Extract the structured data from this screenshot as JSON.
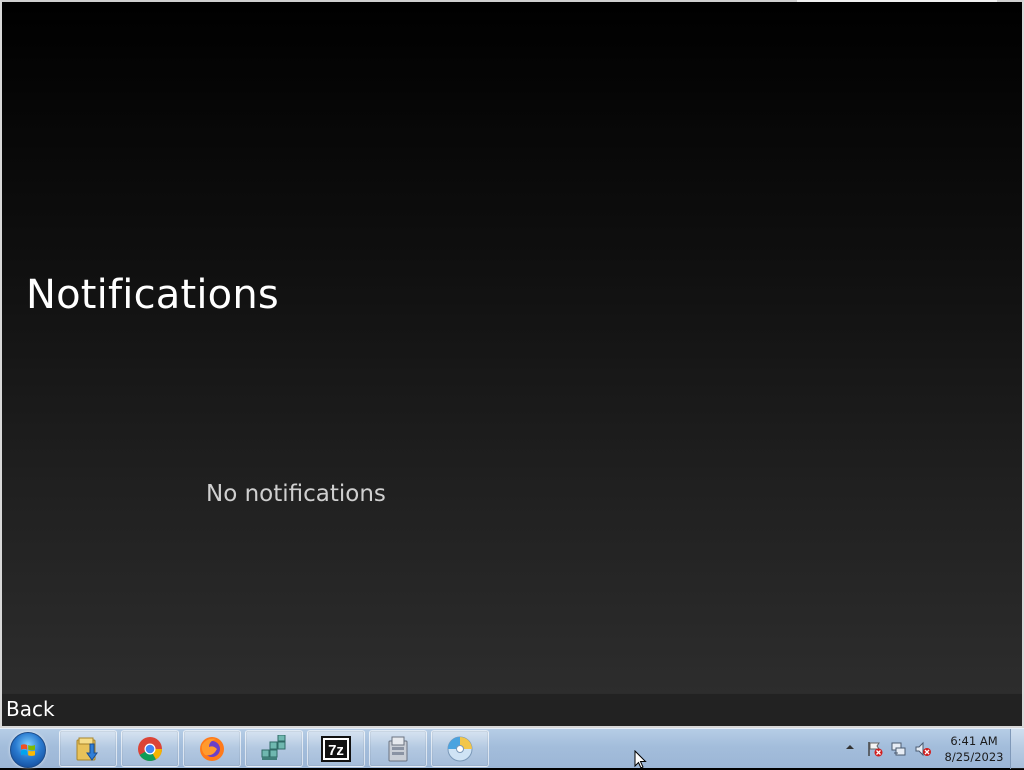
{
  "window": {
    "title": "Notifications",
    "empty_message": "No notifications"
  },
  "app_bar": {
    "back_label": "Back"
  },
  "taskbar": {
    "pinned": [
      {
        "name": "windows-explorer",
        "icon": "folder-icon"
      },
      {
        "name": "google-chrome",
        "icon": "chrome-icon"
      },
      {
        "name": "firefox",
        "icon": "firefox-icon"
      },
      {
        "name": "registry-tool",
        "icon": "registry-cubes-icon"
      },
      {
        "name": "7-zip",
        "icon": "7zip-icon",
        "label": "7z"
      },
      {
        "name": "application-installer",
        "icon": "installer-icon"
      },
      {
        "name": "media-disc",
        "icon": "disc-icon"
      }
    ],
    "clock": {
      "time": "6:41 AM",
      "date": "8/25/2023"
    }
  },
  "colors": {
    "background_top": "#000000",
    "background_bottom": "#2f2f2f",
    "title_text": "#ffffff",
    "message_text": "#cfcfcf",
    "taskbar": "#a3bddb"
  }
}
